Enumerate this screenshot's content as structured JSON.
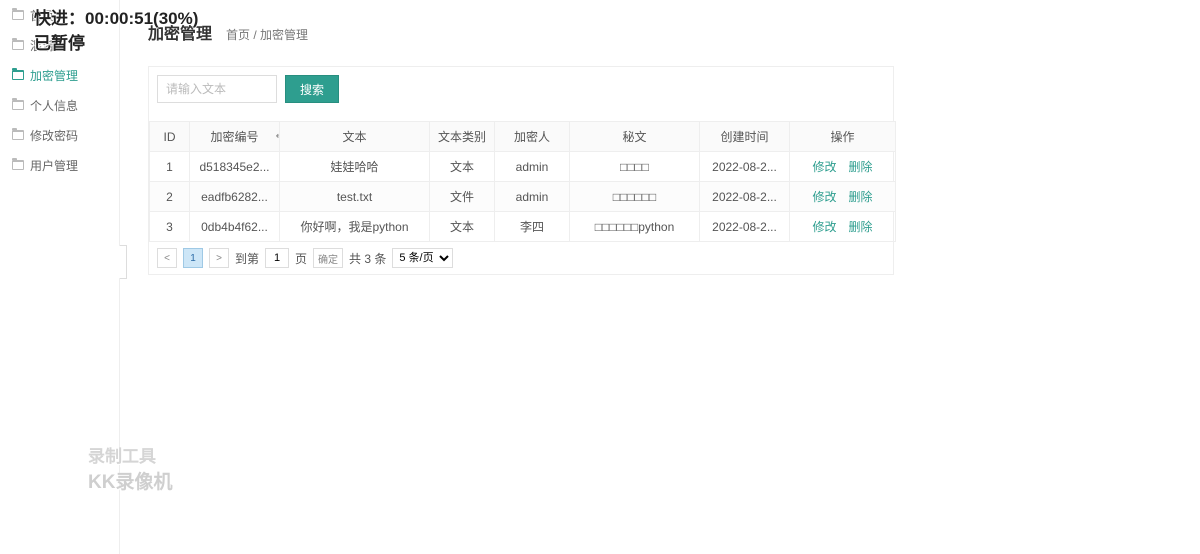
{
  "sidebar": {
    "items": [
      {
        "label": "首页"
      },
      {
        "label": "混淆"
      },
      {
        "label": "加密管理"
      },
      {
        "label": "个人信息"
      },
      {
        "label": "修改密码"
      },
      {
        "label": "用户管理"
      }
    ]
  },
  "header": {
    "title": "加密管理",
    "breadcrumb_home": "首页",
    "breadcrumb_sep": " / ",
    "breadcrumb_current": "加密管理"
  },
  "search": {
    "placeholder": "请输入文本",
    "button": "搜索"
  },
  "table": {
    "headers": {
      "id": "ID",
      "enc_no": "加密编号",
      "text": "文本",
      "type": "文本类别",
      "user": "加密人",
      "cipher": "秘文",
      "ctime": "创建时间",
      "ops": "操作"
    },
    "rows": [
      {
        "id": "1",
        "enc_no": "d518345e2...",
        "text": "娃娃哈哈",
        "type": "文本",
        "user": "admin",
        "cipher": "□□□□",
        "ctime": "2022-08-2..."
      },
      {
        "id": "2",
        "enc_no": "eadfb6282...",
        "text": "test.txt",
        "type": "文件",
        "user": "admin",
        "cipher": "□□□□□□",
        "ctime": "2022-08-2..."
      },
      {
        "id": "3",
        "enc_no": "0db4b4f62...",
        "text": "你好啊，我是python",
        "type": "文本",
        "user": "李四",
        "cipher": "□□□□□□python",
        "ctime": "2022-08-2..."
      }
    ],
    "ops": {
      "edit": "修改",
      "del": "删除"
    }
  },
  "pager": {
    "current": "1",
    "to_label": "到第",
    "page_input": "1",
    "page_unit": "页",
    "confirm": "确定",
    "total": "共 3 条",
    "size": "5 条/页"
  },
  "overlay": {
    "fast": "快进：00:00:51(30%)",
    "paused": "已暂停",
    "tool1": "录制工具",
    "tool2": "KK录像机"
  }
}
